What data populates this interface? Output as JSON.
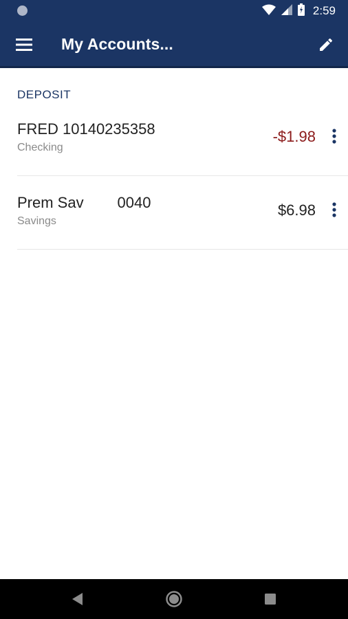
{
  "status_bar": {
    "time": "2:59",
    "icons": [
      "notification-dot-icon",
      "wifi-icon",
      "signal-icon",
      "battery-charging-icon"
    ]
  },
  "app_bar": {
    "title": "My Accounts...",
    "menu_icon": "hamburger-menu-icon",
    "edit_icon": "pencil-edit-icon",
    "color": "#1b3564"
  },
  "section": {
    "header": "DEPOSIT"
  },
  "accounts": [
    {
      "name": "FRED 10140235358",
      "type": "Checking",
      "balance": "-$1.98",
      "balance_color": "#8b1a1a"
    },
    {
      "name": "Prem Sav        0040",
      "type": "Savings",
      "balance": "$6.98",
      "balance_color": "#222222"
    }
  ],
  "nav_bar": {
    "icons": [
      "back-icon",
      "home-icon",
      "recents-icon"
    ]
  }
}
